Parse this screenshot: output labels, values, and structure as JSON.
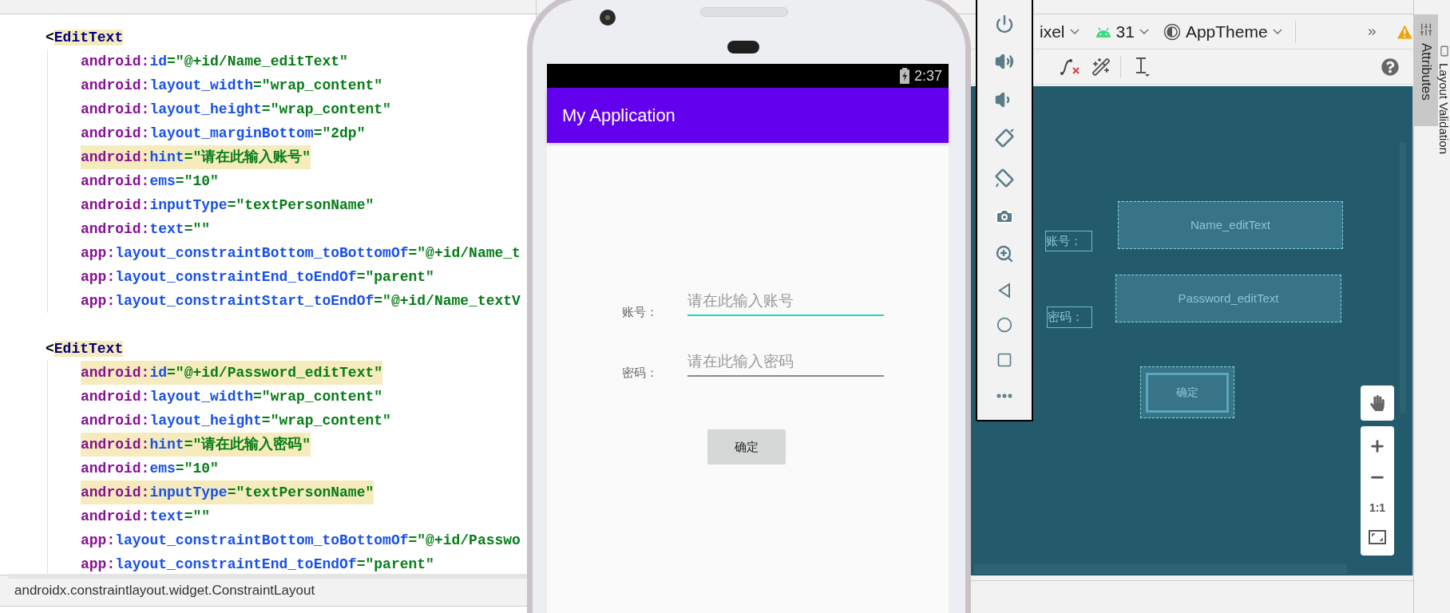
{
  "editor": {
    "blocks": [
      {
        "open": "<",
        "tag": "EditText",
        "tag_highlighted": true,
        "attributes": [
          {
            "ns": "android:",
            "name": "id",
            "value": "=\"@+id/Name_editText\"",
            "highlighted": false
          },
          {
            "ns": "android:",
            "name": "layout_width",
            "value": "=\"wrap_content\"",
            "highlighted": false
          },
          {
            "ns": "android:",
            "name": "layout_height",
            "value": "=\"wrap_content\"",
            "highlighted": false
          },
          {
            "ns": "android:",
            "name": "layout_marginBottom",
            "value": "=\"2dp\"",
            "highlighted": false
          },
          {
            "ns": "android:",
            "name": "hint",
            "value": "=\"请在此输入账号\"",
            "highlighted": true
          },
          {
            "ns": "android:",
            "name": "ems",
            "value": "=\"10\"",
            "highlighted": false
          },
          {
            "ns": "android:",
            "name": "inputType",
            "value": "=\"textPersonName\"",
            "highlighted": false
          },
          {
            "ns": "android:",
            "name": "text",
            "value": "=\"\"",
            "highlighted": false
          },
          {
            "ns": "app:",
            "name": "layout_constraintBottom_toBottomOf",
            "value": "=\"@+id/Name_t",
            "highlighted": false
          },
          {
            "ns": "app:",
            "name": "layout_constraintEnd_toEndOf",
            "value": "=\"parent\"",
            "highlighted": false
          },
          {
            "ns": "app:",
            "name": "layout_constraintStart_toEndOf",
            "value": "=\"@+id/Name_textV",
            "highlighted": false
          }
        ]
      },
      {
        "open": "<",
        "tag": "EditText",
        "tag_highlighted": true,
        "attributes": [
          {
            "ns": "android:",
            "name": "id",
            "value": "=\"@+id/Password_editText\"",
            "highlighted": true
          },
          {
            "ns": "android:",
            "name": "layout_width",
            "value": "=\"wrap_content\"",
            "highlighted": false
          },
          {
            "ns": "android:",
            "name": "layout_height",
            "value": "=\"wrap_content\"",
            "highlighted": false
          },
          {
            "ns": "android:",
            "name": "hint",
            "value": "=\"请在此输入密码\"",
            "highlighted": true
          },
          {
            "ns": "android:",
            "name": "ems",
            "value": "=\"10\"",
            "highlighted": false
          },
          {
            "ns": "android:",
            "name": "inputType",
            "value": "=\"textPersonName\"",
            "highlighted": true
          },
          {
            "ns": "android:",
            "name": "text",
            "value": "=\"\"",
            "highlighted": false
          },
          {
            "ns": "app:",
            "name": "layout_constraintBottom_toBottomOf",
            "value": "=\"@+id/Passwo",
            "highlighted": false
          },
          {
            "ns": "app:",
            "name": "layout_constraintEnd_toEndOf",
            "value": "=\"parent\"",
            "highlighted": false
          }
        ]
      }
    ],
    "breadcrumb": "androidx.constraintlayout.widget.ConstraintLayout"
  },
  "emulator": {
    "status_time": "2:37",
    "app_title": "My Application",
    "rows": [
      {
        "label": "账号：",
        "placeholder": "请在此输入账号",
        "focused": true
      },
      {
        "label": "密码：",
        "placeholder": "请在此输入密码",
        "focused": false
      }
    ],
    "button": "确定",
    "controls": [
      {
        "kind": "power"
      },
      {
        "kind": "volume_up"
      },
      {
        "kind": "volume_down"
      },
      {
        "kind": "rotate_left"
      },
      {
        "kind": "rotate_right"
      },
      {
        "kind": "screenshot"
      },
      {
        "kind": "zoom"
      },
      {
        "kind": "back"
      },
      {
        "kind": "home"
      },
      {
        "kind": "overview"
      },
      {
        "kind": "more"
      }
    ]
  },
  "design": {
    "toolbar": {
      "device": "ixel",
      "api": "31",
      "theme": "AppTheme"
    },
    "blueprint": [
      {
        "kind": "label",
        "text": "账号："
      },
      {
        "kind": "field",
        "text": "Name_editText"
      },
      {
        "kind": "label",
        "text": "密码："
      },
      {
        "kind": "field",
        "text": "Password_editText"
      },
      {
        "kind": "button",
        "text": "确定"
      }
    ],
    "zoom_reset": "1:1"
  },
  "side_tabs": [
    {
      "label": "Attributes",
      "selected": true
    },
    {
      "label": "Layout Validation",
      "selected": false
    }
  ]
}
